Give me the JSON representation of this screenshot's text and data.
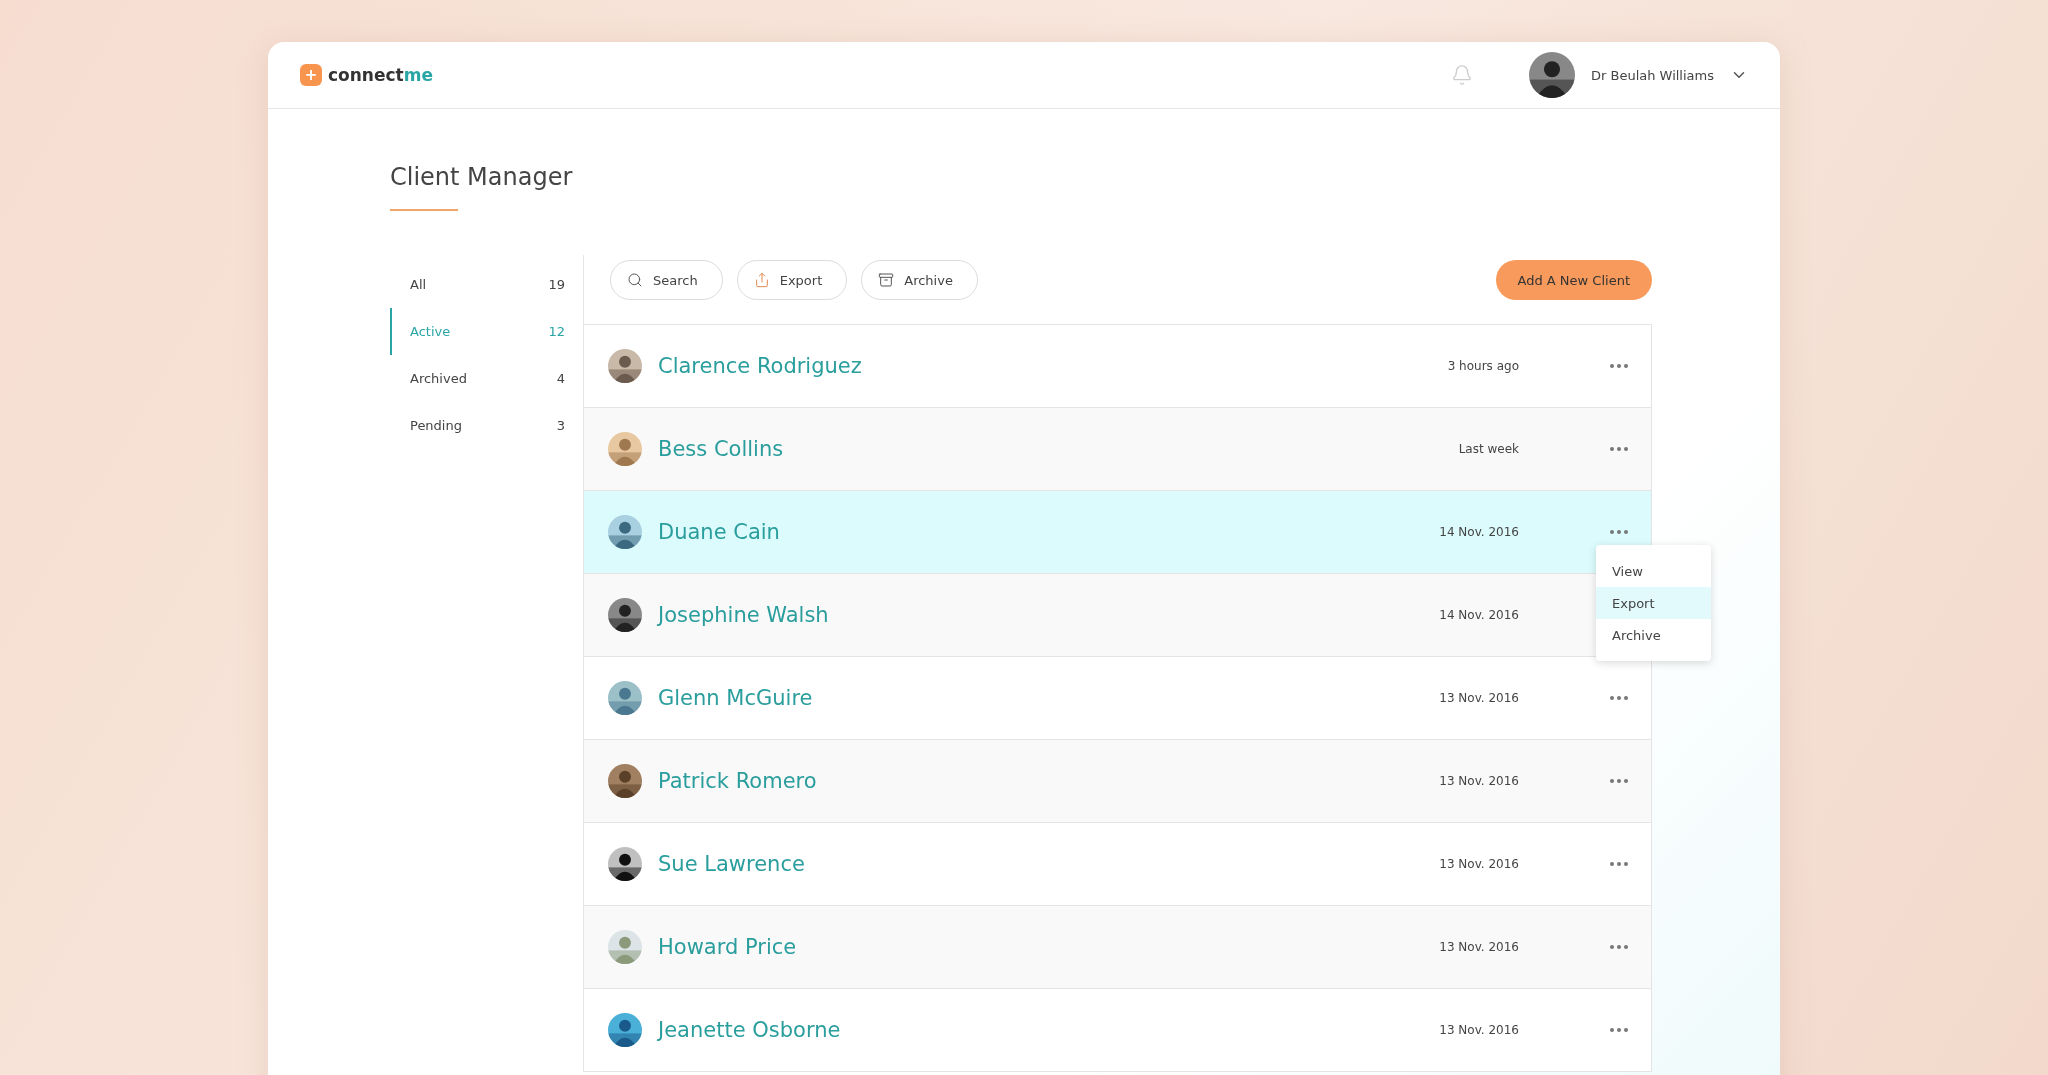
{
  "header": {
    "logo_mark": "+",
    "logo_text": "connect",
    "logo_accent": "me",
    "user_name": "Dr Beulah Williams"
  },
  "page_title": "Client Manager",
  "filters": [
    {
      "label": "All",
      "count": "19",
      "selected": false
    },
    {
      "label": "Active",
      "count": "12",
      "selected": true
    },
    {
      "label": "Archived",
      "count": "4",
      "selected": false
    },
    {
      "label": "Pending",
      "count": "3",
      "selected": false
    }
  ],
  "toolbar": [
    {
      "kind": "search",
      "label": "Search"
    },
    {
      "kind": "export",
      "label": "Export"
    },
    {
      "kind": "archive",
      "label": "Archive"
    }
  ],
  "add_button": "Add A New Client",
  "clients": [
    {
      "name": "Clarence Rodriguez",
      "time": "3 hours ago",
      "selected": false
    },
    {
      "name": "Bess Collins",
      "time": "Last week",
      "selected": false
    },
    {
      "name": "Duane Cain",
      "time": "14 Nov. 2016",
      "selected": true,
      "menu": [
        {
          "label": "View",
          "selected": false
        },
        {
          "label": "Export",
          "selected": true
        },
        {
          "label": "Archive",
          "selected": false
        }
      ]
    },
    {
      "name": "Josephine Walsh",
      "time": "14 Nov. 2016",
      "selected": false
    },
    {
      "name": "Glenn McGuire",
      "time": "13 Nov. 2016",
      "selected": false
    },
    {
      "name": "Patrick Romero",
      "time": "13 Nov. 2016",
      "selected": false
    },
    {
      "name": "Sue Lawrence",
      "time": "13 Nov. 2016",
      "selected": false
    },
    {
      "name": "Howard Price",
      "time": "13 Nov. 2016",
      "selected": false
    },
    {
      "name": "Jeanette Osborne",
      "time": "13 Nov. 2016",
      "selected": false
    }
  ]
}
